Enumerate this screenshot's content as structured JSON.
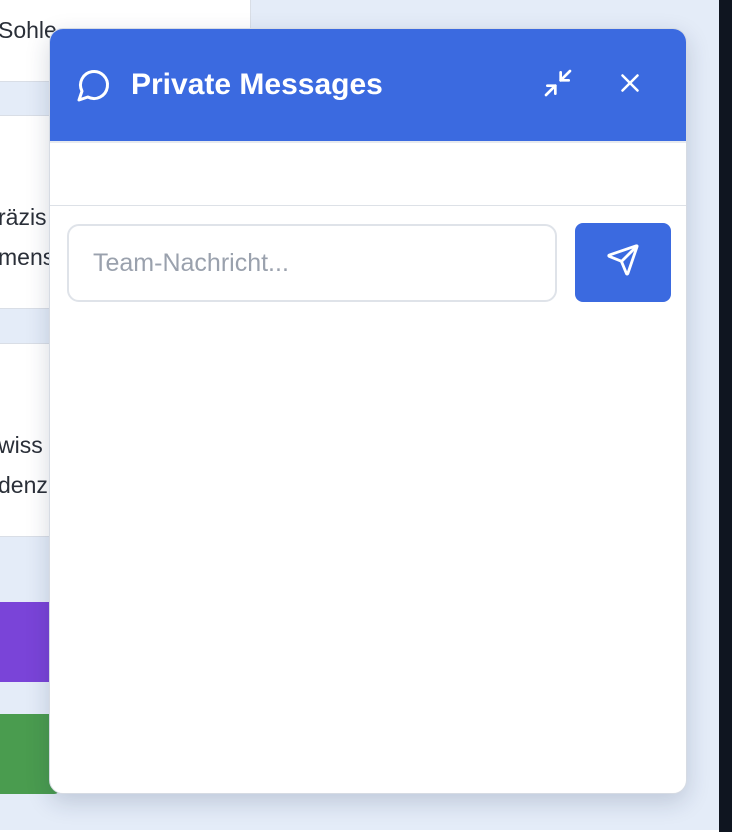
{
  "background": {
    "cards": [
      {
        "lines": [
          "Sohle"
        ]
      },
      {
        "lines": [
          "räzis",
          "mens"
        ]
      },
      {
        "lines": [
          "wiss",
          "denz"
        ]
      }
    ]
  },
  "chat": {
    "title": "Private Messages",
    "header_icon": "chat-bubble-icon",
    "minimize_icon": "minimize-icon",
    "close_icon": "close-icon",
    "input": {
      "value": "",
      "placeholder": "Team-Nachricht..."
    },
    "send_icon": "send-icon"
  },
  "colors": {
    "accent": "#3b6ae0",
    "purple": "#7a44d8",
    "green": "#4a9c4f"
  }
}
